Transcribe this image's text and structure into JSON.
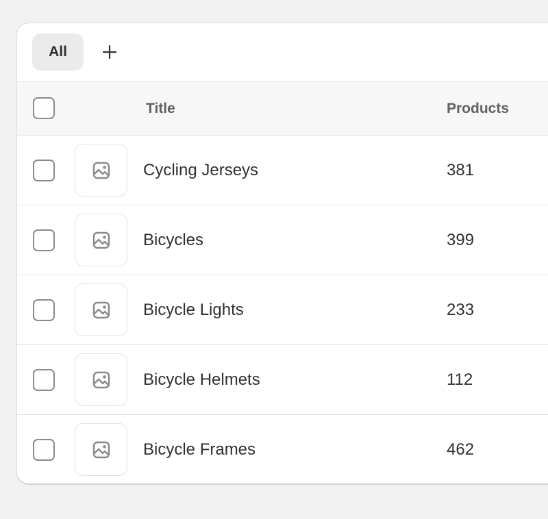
{
  "tabs": [
    {
      "label": "All"
    }
  ],
  "add_view_icon": "plus-icon",
  "table": {
    "columns": {
      "title": "Title",
      "products": "Products"
    },
    "rows": [
      {
        "title": "Cycling Jerseys",
        "products": "381",
        "thumb_icon": "image-placeholder-icon"
      },
      {
        "title": "Bicycles",
        "products": "399",
        "thumb_icon": "image-placeholder-icon"
      },
      {
        "title": "Bicycle Lights",
        "products": "233",
        "thumb_icon": "image-placeholder-icon"
      },
      {
        "title": "Bicycle Helmets",
        "products": "112",
        "thumb_icon": "image-placeholder-icon"
      },
      {
        "title": "Bicycle Frames",
        "products": "462",
        "thumb_icon": "image-placeholder-icon"
      }
    ]
  },
  "colors": {
    "page_bg": "#f1f1f1",
    "header_bg": "#f7f7f7",
    "tab_bg": "#ebebeb",
    "text": "#303030",
    "muted_text": "#616161"
  }
}
